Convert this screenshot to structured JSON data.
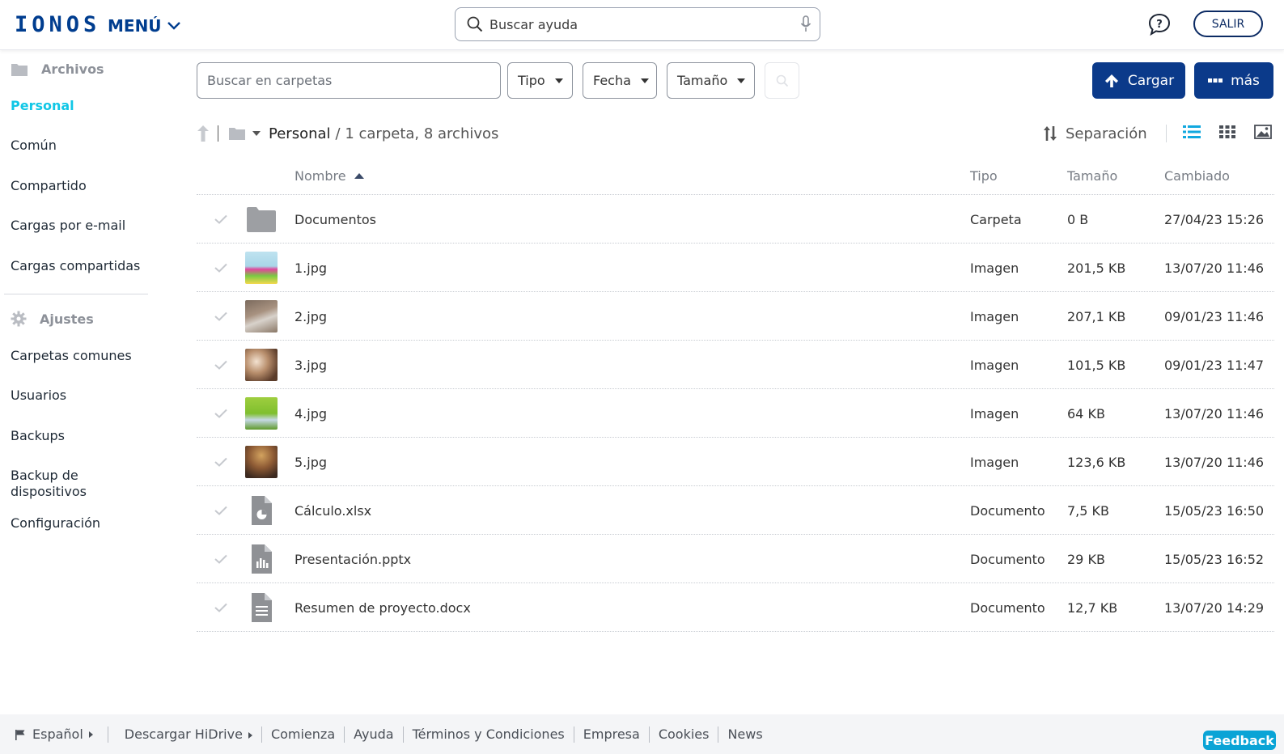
{
  "header": {
    "logo": "IONOS",
    "menu_label": "MENÚ",
    "search_placeholder": "Buscar ayuda",
    "logout_label": "SALIR"
  },
  "sidebar": {
    "files_section": "Archivos",
    "file_items": [
      {
        "label": "Personal",
        "active": true
      },
      {
        "label": "Común"
      },
      {
        "label": "Compartido"
      },
      {
        "label": "Cargas por e-mail"
      },
      {
        "label": "Cargas compartidas"
      }
    ],
    "settings_section": "Ajustes",
    "settings_items": [
      {
        "label": "Carpetas comunes"
      },
      {
        "label": "Usuarios"
      },
      {
        "label": "Backups"
      },
      {
        "label": "Backup de dispositivos"
      },
      {
        "label": "Configuración"
      }
    ]
  },
  "toolbar": {
    "folder_search_placeholder": "Buscar en carpetas",
    "filters": [
      "Tipo",
      "Fecha",
      "Tamaño"
    ],
    "upload_label": "Cargar",
    "more_label": "más"
  },
  "breadcrumb": {
    "folder": "Personal",
    "info": "/ 1 carpeta, 8 archivos",
    "sort_label": "Separación"
  },
  "table": {
    "columns": {
      "name": "Nombre",
      "type": "Tipo",
      "size": "Tamaño",
      "changed": "Cambiado"
    },
    "rows": [
      {
        "name": "Documentos",
        "type": "Carpeta",
        "size": "0 B",
        "changed": "27/04/23 15:26",
        "icon": "folder-icon"
      },
      {
        "name": "1.jpg",
        "type": "Imagen",
        "size": "201,5 KB",
        "changed": "13/07/20 11:46",
        "icon": "image-thumbnail"
      },
      {
        "name": "2.jpg",
        "type": "Imagen",
        "size": "207,1 KB",
        "changed": "09/01/23 11:46",
        "icon": "image-thumbnail"
      },
      {
        "name": "3.jpg",
        "type": "Imagen",
        "size": "101,5 KB",
        "changed": "09/01/23 11:47",
        "icon": "image-thumbnail"
      },
      {
        "name": "4.jpg",
        "type": "Imagen",
        "size": "64 KB",
        "changed": "13/07/20 11:46",
        "icon": "image-thumbnail"
      },
      {
        "name": "5.jpg",
        "type": "Imagen",
        "size": "123,6 KB",
        "changed": "13/07/20 11:46",
        "icon": "image-thumbnail"
      },
      {
        "name": "Cálculo.xlsx",
        "type": "Documento",
        "size": "7,5 KB",
        "changed": "15/05/23 16:50",
        "icon": "spreadsheet-file-icon"
      },
      {
        "name": "Presentación.pptx",
        "type": "Documento",
        "size": "29 KB",
        "changed": "15/05/23 16:52",
        "icon": "presentation-file-icon"
      },
      {
        "name": "Resumen de proyecto.docx",
        "type": "Documento",
        "size": "12,7 KB",
        "changed": "13/07/20 14:29",
        "icon": "document-file-icon"
      }
    ]
  },
  "footer": {
    "language": "Español",
    "links": [
      "Descargar HiDrive",
      "Comienza",
      "Ayuda",
      "Términos y Condiciones",
      "Empresa",
      "Cookies",
      "News"
    ],
    "feedback": "Feedback"
  },
  "colors": {
    "brand": "#003d8f",
    "primary_button": "#0b3a8a",
    "active_nav": "#11c7e6",
    "feedback": "#0aa4d6"
  }
}
